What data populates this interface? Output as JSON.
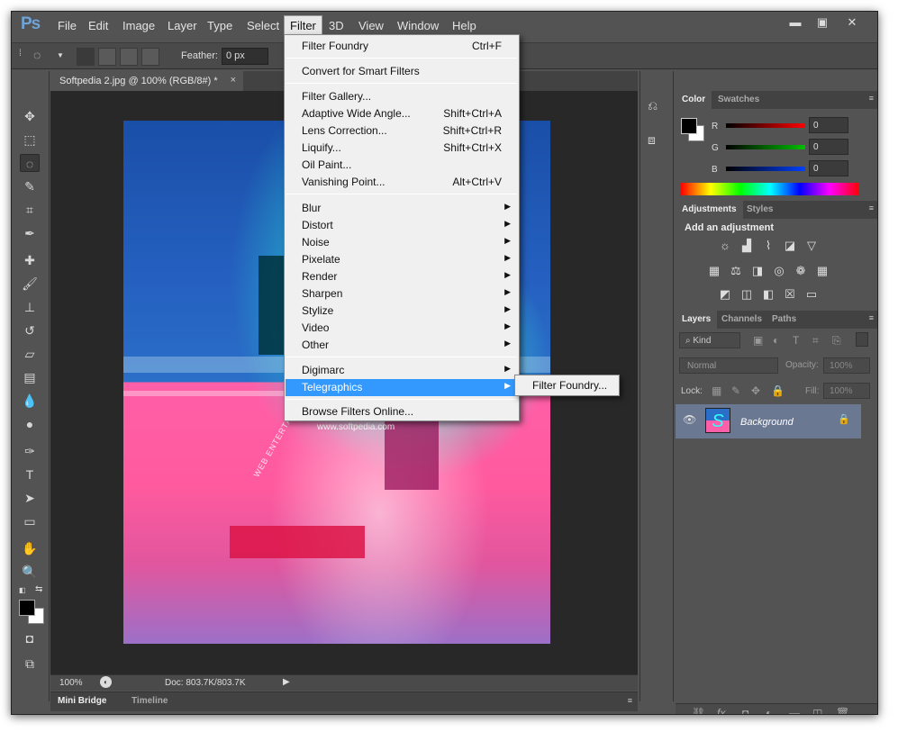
{
  "app": {
    "logo": "Ps"
  },
  "menubar": {
    "items": [
      "File",
      "Edit",
      "Image",
      "Layer",
      "Type",
      "Select",
      "Filter",
      "3D",
      "View",
      "Window",
      "Help"
    ],
    "active": "Filter"
  },
  "window_controls": {
    "minimize": "▬",
    "maximize": "▣",
    "close": "✕"
  },
  "options": {
    "feather_label": "Feather:",
    "feather_value": "0 px"
  },
  "document": {
    "tab_title": "Softpedia 2.jpg @ 100% (RGB/8#) *",
    "tab_close": "×",
    "image_watermark": "www.softpedia.com",
    "image_text": "WEB ENTERTAINMENT"
  },
  "status": {
    "zoom": "100%",
    "doc_info": "Doc: 803.7K/803.7K"
  },
  "bottom_tabs": [
    "Mini Bridge",
    "Timeline"
  ],
  "filter_menu": {
    "sections": [
      [
        {
          "label": "Filter Foundry",
          "shortcut": "Ctrl+F"
        }
      ],
      [
        {
          "label": "Convert for Smart Filters",
          "shortcut": ""
        }
      ],
      [
        {
          "label": "Filter Gallery...",
          "shortcut": ""
        },
        {
          "label": "Adaptive Wide Angle...",
          "shortcut": "Shift+Ctrl+A"
        },
        {
          "label": "Lens Correction...",
          "shortcut": "Shift+Ctrl+R"
        },
        {
          "label": "Liquify...",
          "shortcut": "Shift+Ctrl+X"
        },
        {
          "label": "Oil Paint...",
          "shortcut": ""
        },
        {
          "label": "Vanishing Point...",
          "shortcut": "Alt+Ctrl+V"
        }
      ],
      [
        {
          "label": "Blur",
          "submenu": true
        },
        {
          "label": "Distort",
          "submenu": true
        },
        {
          "label": "Noise",
          "submenu": true
        },
        {
          "label": "Pixelate",
          "submenu": true
        },
        {
          "label": "Render",
          "submenu": true
        },
        {
          "label": "Sharpen",
          "submenu": true
        },
        {
          "label": "Stylize",
          "submenu": true
        },
        {
          "label": "Video",
          "submenu": true
        },
        {
          "label": "Other",
          "submenu": true
        }
      ],
      [
        {
          "label": "Digimarc",
          "submenu": true
        },
        {
          "label": "Telegraphics",
          "submenu": true,
          "highlighted": true
        }
      ],
      [
        {
          "label": "Browse Filters Online...",
          "shortcut": ""
        }
      ]
    ],
    "submenu_item": "Filter Foundry..."
  },
  "color_panel": {
    "tabs": [
      "Color",
      "Swatches"
    ],
    "channels": [
      {
        "label": "R",
        "value": "0",
        "color": "#ff0000"
      },
      {
        "label": "G",
        "value": "0",
        "color": "#00c000"
      },
      {
        "label": "B",
        "value": "0",
        "color": "#0040ff"
      }
    ]
  },
  "adjustments_panel": {
    "tabs": [
      "Adjustments",
      "Styles"
    ],
    "title": "Add an adjustment"
  },
  "layers_panel": {
    "tabs": [
      "Layers",
      "Channels",
      "Paths"
    ],
    "kind": "Kind",
    "blend_mode": "Normal",
    "opacity_label": "Opacity:",
    "opacity_value": "100%",
    "lock_label": "Lock:",
    "fill_label": "Fill:",
    "fill_value": "100%",
    "layer_name": "Background",
    "thumbnail_letter": "S"
  },
  "colors": {
    "accent": "#3399ff",
    "menu_bg": "#f0f0f0",
    "panel_bg": "#535353"
  }
}
